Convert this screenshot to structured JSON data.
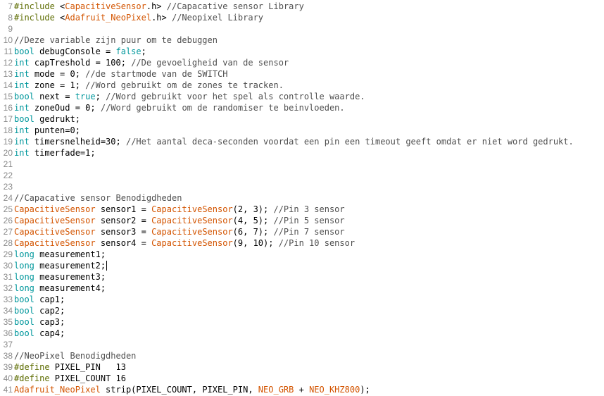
{
  "editor": {
    "colors": {
      "type": "#00979c",
      "preprocessor": "#5e6d03",
      "library_class": "#d35400",
      "literal": "#00979c",
      "comment": "#4f4f4f",
      "text": "#000000",
      "line_number": "#8a8a8a"
    },
    "caret_line": 30,
    "lines": [
      {
        "n": "7",
        "tokens": [
          {
            "k": "pre",
            "t": "#include"
          },
          {
            "k": "txt",
            "t": " <"
          },
          {
            "k": "lib",
            "t": "CapacitiveSensor"
          },
          {
            "k": "txt",
            "t": ".h> "
          },
          {
            "k": "com",
            "t": "//Capacative sensor Library"
          }
        ]
      },
      {
        "n": "8",
        "tokens": [
          {
            "k": "pre",
            "t": "#include"
          },
          {
            "k": "txt",
            "t": " <"
          },
          {
            "k": "lib",
            "t": "Adafruit_NeoPixel"
          },
          {
            "k": "txt",
            "t": ".h> "
          },
          {
            "k": "com",
            "t": "//Neopixel Library"
          }
        ]
      },
      {
        "n": "9",
        "tokens": []
      },
      {
        "n": "10",
        "tokens": [
          {
            "k": "com",
            "t": "//Deze variable zijn puur om te debuggen"
          }
        ]
      },
      {
        "n": "11",
        "tokens": [
          {
            "k": "type",
            "t": "bool"
          },
          {
            "k": "txt",
            "t": " debugConsole = "
          },
          {
            "k": "lit",
            "t": "false"
          },
          {
            "k": "txt",
            "t": ";"
          }
        ]
      },
      {
        "n": "12",
        "tokens": [
          {
            "k": "type",
            "t": "int"
          },
          {
            "k": "txt",
            "t": " capTreshold = 100; "
          },
          {
            "k": "com",
            "t": "//De gevoeligheid van de sensor"
          }
        ]
      },
      {
        "n": "13",
        "tokens": [
          {
            "k": "type",
            "t": "int"
          },
          {
            "k": "txt",
            "t": " mode = 0; "
          },
          {
            "k": "com",
            "t": "//de startmode van de SWITCH"
          }
        ]
      },
      {
        "n": "14",
        "tokens": [
          {
            "k": "type",
            "t": "int"
          },
          {
            "k": "txt",
            "t": " zone = 1; "
          },
          {
            "k": "com",
            "t": "//Word gebruikt om de zones te tracken."
          }
        ]
      },
      {
        "n": "15",
        "tokens": [
          {
            "k": "type",
            "t": "bool"
          },
          {
            "k": "txt",
            "t": " next = "
          },
          {
            "k": "lit",
            "t": "true"
          },
          {
            "k": "txt",
            "t": "; "
          },
          {
            "k": "com",
            "t": "//Word gebruikt voor het spel als controlle waarde."
          }
        ]
      },
      {
        "n": "16",
        "tokens": [
          {
            "k": "type",
            "t": "int"
          },
          {
            "k": "txt",
            "t": " zoneOud = 0; "
          },
          {
            "k": "com",
            "t": "//Word gebruikt om de randomiser te beinvloeden."
          }
        ]
      },
      {
        "n": "17",
        "tokens": [
          {
            "k": "type",
            "t": "bool"
          },
          {
            "k": "txt",
            "t": " gedrukt;"
          }
        ]
      },
      {
        "n": "18",
        "tokens": [
          {
            "k": "type",
            "t": "int"
          },
          {
            "k": "txt",
            "t": " punten=0;"
          }
        ]
      },
      {
        "n": "19",
        "tokens": [
          {
            "k": "type",
            "t": "int"
          },
          {
            "k": "txt",
            "t": " timersnelheid=30; "
          },
          {
            "k": "com",
            "t": "//Het aantal deca-seconden voordat een pin een timeout geeft omdat er niet word gedrukt."
          }
        ]
      },
      {
        "n": "20",
        "tokens": [
          {
            "k": "type",
            "t": "int"
          },
          {
            "k": "txt",
            "t": " timerfade=1;"
          }
        ]
      },
      {
        "n": "21",
        "tokens": []
      },
      {
        "n": "22",
        "tokens": []
      },
      {
        "n": "23",
        "tokens": []
      },
      {
        "n": "24",
        "tokens": [
          {
            "k": "com",
            "t": "//Capacative sensor Benodigdheden"
          }
        ]
      },
      {
        "n": "25",
        "tokens": [
          {
            "k": "lib",
            "t": "CapacitiveSensor"
          },
          {
            "k": "txt",
            "t": " sensor1 = "
          },
          {
            "k": "lib",
            "t": "CapacitiveSensor"
          },
          {
            "k": "txt",
            "t": "(2, 3); "
          },
          {
            "k": "com",
            "t": "//Pin 3 sensor"
          }
        ]
      },
      {
        "n": "26",
        "tokens": [
          {
            "k": "lib",
            "t": "CapacitiveSensor"
          },
          {
            "k": "txt",
            "t": " sensor2 = "
          },
          {
            "k": "lib",
            "t": "CapacitiveSensor"
          },
          {
            "k": "txt",
            "t": "(4, 5); "
          },
          {
            "k": "com",
            "t": "//Pin 5 sensor"
          }
        ]
      },
      {
        "n": "27",
        "tokens": [
          {
            "k": "lib",
            "t": "CapacitiveSensor"
          },
          {
            "k": "txt",
            "t": " sensor3 = "
          },
          {
            "k": "lib",
            "t": "CapacitiveSensor"
          },
          {
            "k": "txt",
            "t": "(6, 7); "
          },
          {
            "k": "com",
            "t": "//Pin 7 sensor"
          }
        ]
      },
      {
        "n": "28",
        "tokens": [
          {
            "k": "lib",
            "t": "CapacitiveSensor"
          },
          {
            "k": "txt",
            "t": " sensor4 = "
          },
          {
            "k": "lib",
            "t": "CapacitiveSensor"
          },
          {
            "k": "txt",
            "t": "(9, 10); "
          },
          {
            "k": "com",
            "t": "//Pin 10 sensor"
          }
        ]
      },
      {
        "n": "29",
        "tokens": [
          {
            "k": "type",
            "t": "long"
          },
          {
            "k": "txt",
            "t": " measurement1;"
          }
        ]
      },
      {
        "n": "30",
        "tokens": [
          {
            "k": "type",
            "t": "long"
          },
          {
            "k": "txt",
            "t": " measurement2;"
          }
        ]
      },
      {
        "n": "31",
        "tokens": [
          {
            "k": "type",
            "t": "long"
          },
          {
            "k": "txt",
            "t": " measurement3;"
          }
        ]
      },
      {
        "n": "32",
        "tokens": [
          {
            "k": "type",
            "t": "long"
          },
          {
            "k": "txt",
            "t": " measurement4;"
          }
        ]
      },
      {
        "n": "33",
        "tokens": [
          {
            "k": "type",
            "t": "bool"
          },
          {
            "k": "txt",
            "t": " cap1;"
          }
        ]
      },
      {
        "n": "34",
        "tokens": [
          {
            "k": "type",
            "t": "bool"
          },
          {
            "k": "txt",
            "t": " cap2;"
          }
        ]
      },
      {
        "n": "35",
        "tokens": [
          {
            "k": "type",
            "t": "bool"
          },
          {
            "k": "txt",
            "t": " cap3;"
          }
        ]
      },
      {
        "n": "36",
        "tokens": [
          {
            "k": "type",
            "t": "bool"
          },
          {
            "k": "txt",
            "t": " cap4;"
          }
        ]
      },
      {
        "n": "37",
        "tokens": []
      },
      {
        "n": "38",
        "tokens": [
          {
            "k": "com",
            "t": "//NeoPixel Benodigdheden"
          }
        ]
      },
      {
        "n": "39",
        "tokens": [
          {
            "k": "pre",
            "t": "#define"
          },
          {
            "k": "txt",
            "t": " PIXEL_PIN   13"
          }
        ]
      },
      {
        "n": "40",
        "tokens": [
          {
            "k": "pre",
            "t": "#define"
          },
          {
            "k": "txt",
            "t": " PIXEL_COUNT 16"
          }
        ]
      },
      {
        "n": "41",
        "tokens": [
          {
            "k": "lib",
            "t": "Adafruit_NeoPixel"
          },
          {
            "k": "txt",
            "t": " strip(PIXEL_COUNT, PIXEL_PIN, "
          },
          {
            "k": "lib",
            "t": "NEO_GRB"
          },
          {
            "k": "txt",
            "t": " + "
          },
          {
            "k": "lib",
            "t": "NEO_KHZ800"
          },
          {
            "k": "txt",
            "t": ");"
          }
        ]
      }
    ]
  }
}
